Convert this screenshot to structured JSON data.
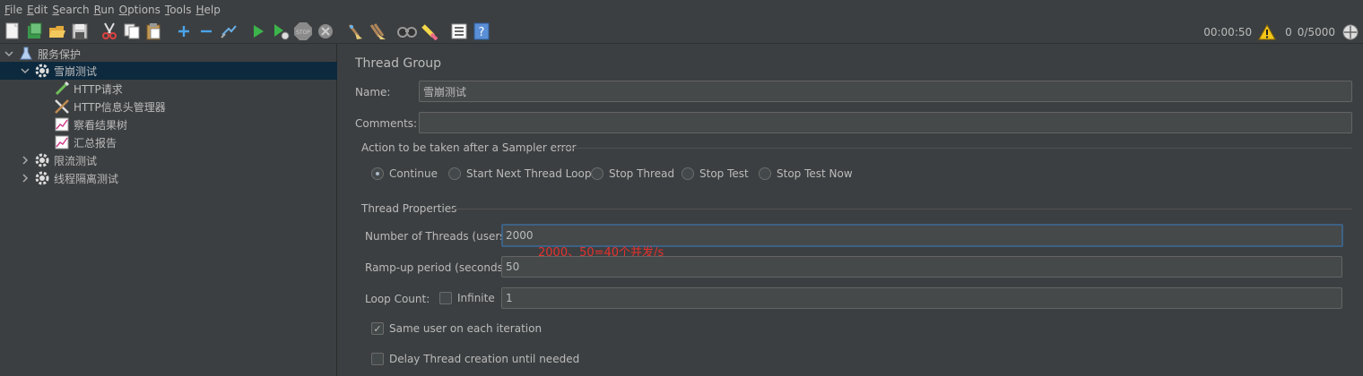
{
  "menu": [
    {
      "mn": "F",
      "rest": "ile"
    },
    {
      "mn": "E",
      "rest": "dit"
    },
    {
      "mn": "S",
      "rest": "earch"
    },
    {
      "mn": "R",
      "rest": "un"
    },
    {
      "mn": "O",
      "rest": "ptions"
    },
    {
      "mn": "T",
      "rest": "ools"
    },
    {
      "mn": "H",
      "rest": "elp"
    }
  ],
  "toolbar": {
    "icons": [
      "new-icon",
      "templates-icon",
      "open-icon",
      "save-icon",
      "cut-icon",
      "copy-icon",
      "paste-icon",
      "expand-icon",
      "collapse-icon",
      "toggle-icon",
      "start-icon",
      "start-no-pause-icon",
      "stop-icon",
      "shutdown-icon",
      "clear-icon",
      "clear-all-icon",
      "search-icon",
      "reset-search-icon",
      "function-helper-icon",
      "help-icon"
    ],
    "elapsed": "00:00:50",
    "warnings": "0",
    "threads": "0/5000"
  },
  "tree": {
    "root": "服务保护",
    "groups": [
      {
        "label": "雪崩测试",
        "expanded": true,
        "children": [
          "HTTP请求",
          "HTTP信息头管理器",
          "察看结果树",
          "汇总报告"
        ]
      },
      {
        "label": "限流测试",
        "expanded": false
      },
      {
        "label": "线程隔离测试",
        "expanded": false
      }
    ]
  },
  "panel": {
    "title": "Thread Group",
    "name_label": "Name:",
    "name_value": "雪崩测试",
    "comments_label": "Comments:",
    "comments_value": "",
    "error_section": "Action to be taken after a Sampler error",
    "error_options": [
      "Continue",
      "Start Next Thread Loop",
      "Stop Thread",
      "Stop Test",
      "Stop Test Now"
    ],
    "error_selected": 0,
    "props_section": "Thread Properties",
    "threads_label": "Number of Threads (users):",
    "threads_value": "2000",
    "rampup_label": "Ramp-up period (seconds):",
    "rampup_value": "50",
    "loop_label": "Loop Count:",
    "infinite_label": "Infinite",
    "loop_value": "1",
    "same_user_label": "Same user on each iteration",
    "same_user_checked": true,
    "delay_label": "Delay Thread creation until needed",
    "delay_checked": false,
    "annotation": "2000、50=40个并发/s"
  }
}
